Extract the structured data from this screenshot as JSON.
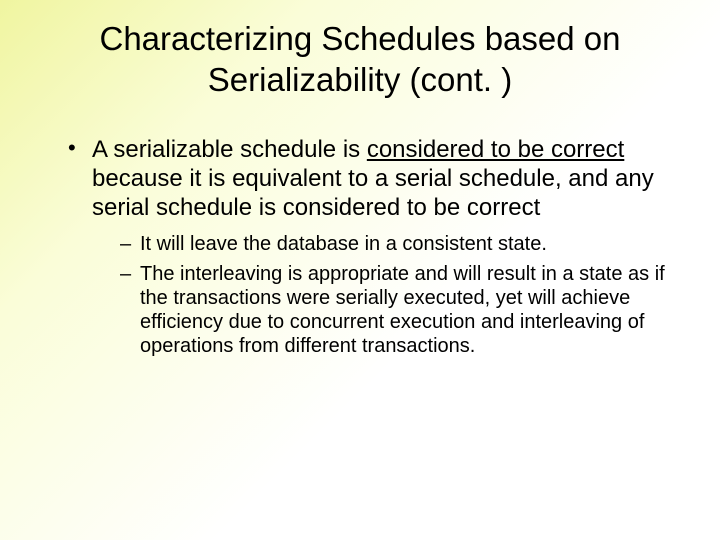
{
  "title": "Characterizing Schedules based on Serializability (cont. )",
  "bullet1_pre": "A serializable schedule is ",
  "bullet1_underlined": "considered to be correct",
  "bullet1_post": " because it is equivalent to a serial schedule, and any serial schedule is considered to be correct",
  "sub1": "It will leave the database in a consistent state.",
  "sub2": "The interleaving is appropriate and will result in a state as if the transactions were serially executed, yet will achieve efficiency due to concurrent execution and interleaving of operations from different transactions."
}
